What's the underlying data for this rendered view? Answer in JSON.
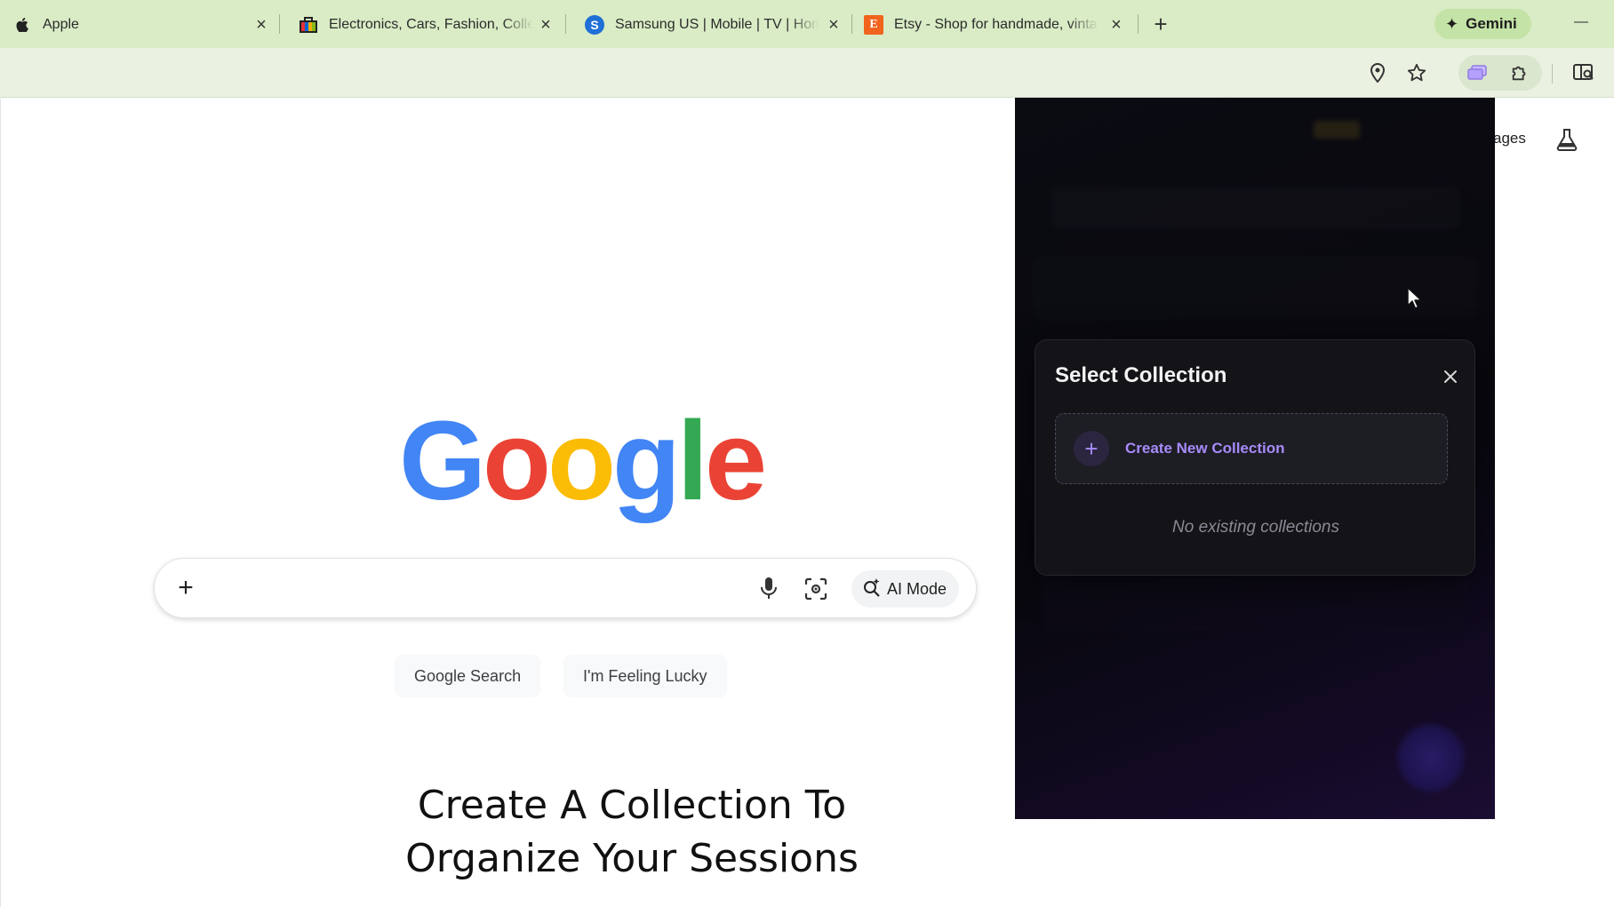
{
  "browser": {
    "tabs": [
      {
        "title": "Apple",
        "favicon": "apple-logo-icon"
      },
      {
        "title": "Electronics, Cars, Fashion, Collectibles & More | eBay",
        "favicon": "ebay-bag-icon"
      },
      {
        "title": "Samsung US | Mobile | TV | Home Electronics",
        "favicon_text": "S",
        "favicon_color": "#1f6fd6"
      },
      {
        "title": "Etsy - Shop for handmade, vintage, custom, and unique gifts",
        "favicon_text": "E",
        "favicon_color": "#f1641e"
      }
    ],
    "gemini_label": "Gemini",
    "accent_tab_bg": "#d9ecc5"
  },
  "google": {
    "logo_letters": [
      {
        "ch": "G",
        "color": "#4285F4"
      },
      {
        "ch": "o",
        "color": "#EA4335"
      },
      {
        "ch": "o",
        "color": "#FBBC05"
      },
      {
        "ch": "g",
        "color": "#4285F4"
      },
      {
        "ch": "l",
        "color": "#34A853"
      },
      {
        "ch": "e",
        "color": "#EA4335"
      }
    ],
    "ai_mode_label": "AI Mode",
    "search_button": "Google Search",
    "lucky_button": "I'm Feeling Lucky",
    "images_link": "ages"
  },
  "overlay_caption": {
    "line1": "Create A Collection To",
    "line2": "Organize Your Sessions"
  },
  "extension": {
    "modal_title": "Select Collection",
    "create_label": "Create New Collection",
    "empty_text": "No existing collections",
    "accent_color": "#a78bfa"
  }
}
